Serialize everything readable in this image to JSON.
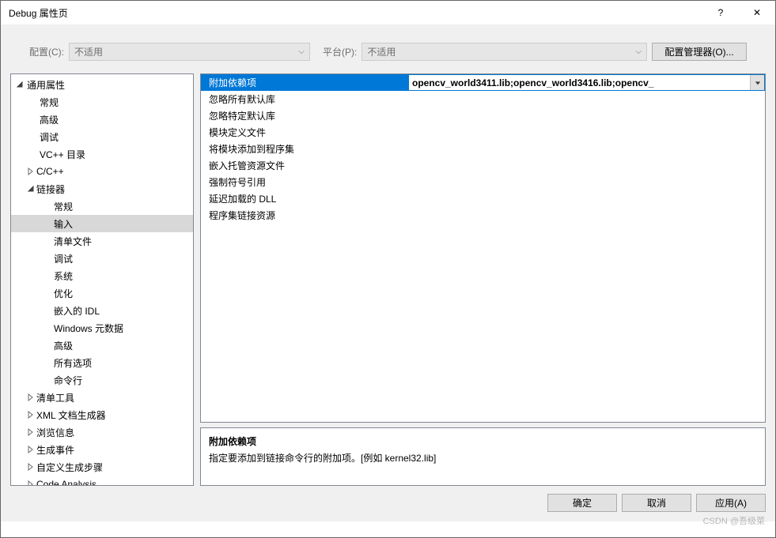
{
  "title": "Debug 属性页",
  "help_label": "?",
  "close_label": "✕",
  "config": {
    "config_label": "配置(C):",
    "config_value": "不适用",
    "platform_label": "平台(P):",
    "platform_value": "不适用",
    "manager_label": "配置管理器(O)..."
  },
  "tree": [
    {
      "label": "通用属性",
      "indent": 0,
      "expander": "open"
    },
    {
      "label": "常规",
      "indent": 1,
      "expander": "none"
    },
    {
      "label": "高级",
      "indent": 1,
      "expander": "none"
    },
    {
      "label": "调试",
      "indent": 1,
      "expander": "none"
    },
    {
      "label": "VC++ 目录",
      "indent": 1,
      "expander": "none"
    },
    {
      "label": "C/C++",
      "indent": 1,
      "expander": "closed"
    },
    {
      "label": "链接器",
      "indent": 1,
      "expander": "open"
    },
    {
      "label": "常规",
      "indent": 2,
      "expander": "none"
    },
    {
      "label": "输入",
      "indent": 2,
      "expander": "none",
      "selected": true
    },
    {
      "label": "清单文件",
      "indent": 2,
      "expander": "none"
    },
    {
      "label": "调试",
      "indent": 2,
      "expander": "none"
    },
    {
      "label": "系统",
      "indent": 2,
      "expander": "none"
    },
    {
      "label": "优化",
      "indent": 2,
      "expander": "none"
    },
    {
      "label": "嵌入的 IDL",
      "indent": 2,
      "expander": "none"
    },
    {
      "label": "Windows 元数据",
      "indent": 2,
      "expander": "none"
    },
    {
      "label": "高级",
      "indent": 2,
      "expander": "none"
    },
    {
      "label": "所有选项",
      "indent": 2,
      "expander": "none"
    },
    {
      "label": "命令行",
      "indent": 2,
      "expander": "none"
    },
    {
      "label": "清单工具",
      "indent": 1,
      "expander": "closed"
    },
    {
      "label": "XML 文档生成器",
      "indent": 1,
      "expander": "closed"
    },
    {
      "label": "浏览信息",
      "indent": 1,
      "expander": "closed"
    },
    {
      "label": "生成事件",
      "indent": 1,
      "expander": "closed"
    },
    {
      "label": "自定义生成步骤",
      "indent": 1,
      "expander": "closed"
    },
    {
      "label": "Code Analysis",
      "indent": 1,
      "expander": "closed"
    }
  ],
  "properties": [
    {
      "name": "附加依赖项",
      "value": "opencv_world3411.lib;opencv_world3416.lib;opencv_",
      "selected": true
    },
    {
      "name": "忽略所有默认库",
      "value": ""
    },
    {
      "name": "忽略特定默认库",
      "value": ""
    },
    {
      "name": "模块定义文件",
      "value": ""
    },
    {
      "name": "将模块添加到程序集",
      "value": ""
    },
    {
      "name": "嵌入托管资源文件",
      "value": ""
    },
    {
      "name": "强制符号引用",
      "value": ""
    },
    {
      "name": "延迟加载的 DLL",
      "value": ""
    },
    {
      "name": "程序集链接资源",
      "value": ""
    }
  ],
  "description": {
    "title": "附加依赖项",
    "text": "指定要添加到链接命令行的附加项。[例如 kernel32.lib]"
  },
  "buttons": {
    "ok": "确定",
    "cancel": "取消",
    "apply": "应用(A)"
  },
  "watermark": "CSDN @吾级菜"
}
